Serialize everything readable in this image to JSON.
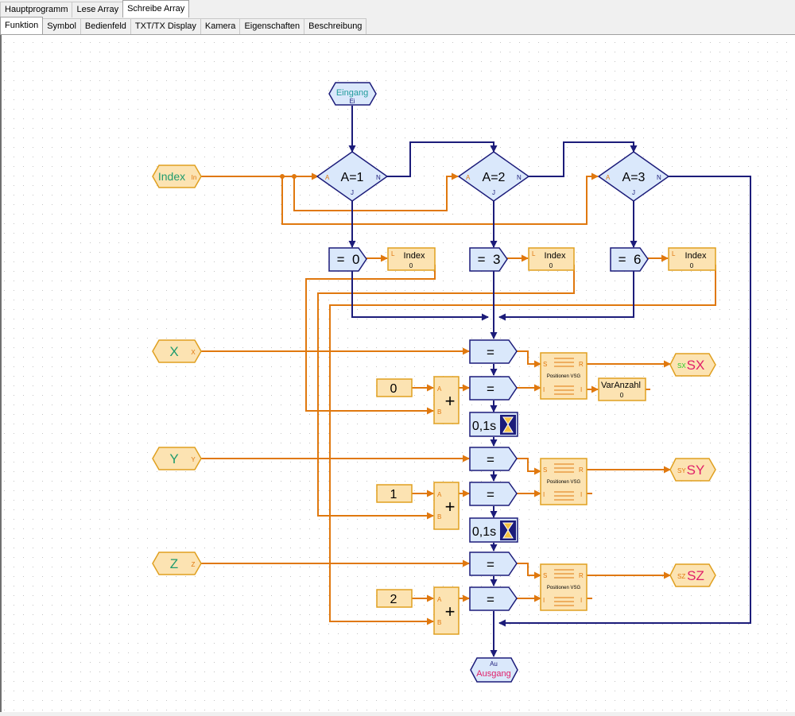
{
  "tabs_top": [
    "Hauptprogramm",
    "Lese Array",
    "Schreibe Array"
  ],
  "tabs_sub": [
    "Funktion",
    "Symbol",
    "Bedienfeld",
    "TXT/TX Display",
    "Kamera",
    "Eigenschaften",
    "Beschreibung"
  ],
  "entry": {
    "label": "Eingang",
    "port": "Ei"
  },
  "exit": {
    "port": "Au",
    "label": "Ausgang"
  },
  "inputs": [
    {
      "label": "Index",
      "port": "In"
    },
    {
      "label": "X",
      "port": "X"
    },
    {
      "label": "Y",
      "port": "Y"
    },
    {
      "label": "Z",
      "port": "Z"
    }
  ],
  "branches": [
    {
      "cond": "A=1",
      "port_a": "A",
      "port_n": "N",
      "port_j": "J",
      "assign": "=  0",
      "var": "Index",
      "var_port": "L",
      "var_val": "0"
    },
    {
      "cond": "A=2",
      "port_a": "A",
      "port_n": "N",
      "port_j": "J",
      "assign": "=  3",
      "var": "Index",
      "var_port": "L",
      "var_val": "0"
    },
    {
      "cond": "A=3",
      "port_a": "A",
      "port_n": "N",
      "port_j": "J",
      "assign": "=  6",
      "var": "Index",
      "var_port": "L",
      "var_val": "0"
    }
  ],
  "eq_label": "=",
  "plus_label": "+",
  "plus_ports": [
    "A",
    "B"
  ],
  "constants": [
    "0",
    "1",
    "2"
  ],
  "waits": [
    "0,1s",
    "0,1s"
  ],
  "list": {
    "name": "Positionen VSG",
    "ports": [
      "S",
      "R",
      "I",
      "I"
    ]
  },
  "varanzahl": {
    "name": "VarAnzahl",
    "val": "0"
  },
  "outputs": [
    {
      "label": "SX",
      "port": "SX"
    },
    {
      "label": "SY",
      "port": "SY"
    },
    {
      "label": "SZ",
      "port": "SZ"
    }
  ],
  "colors": {
    "control": "#1c1c7a",
    "data": "#e0780e",
    "node_fill": "#dae8fb",
    "var_fill": "#fce3b2",
    "label_green": "#1f9b6e",
    "label_pink": "#e0206a",
    "label_teal": "#1f9b9b"
  }
}
